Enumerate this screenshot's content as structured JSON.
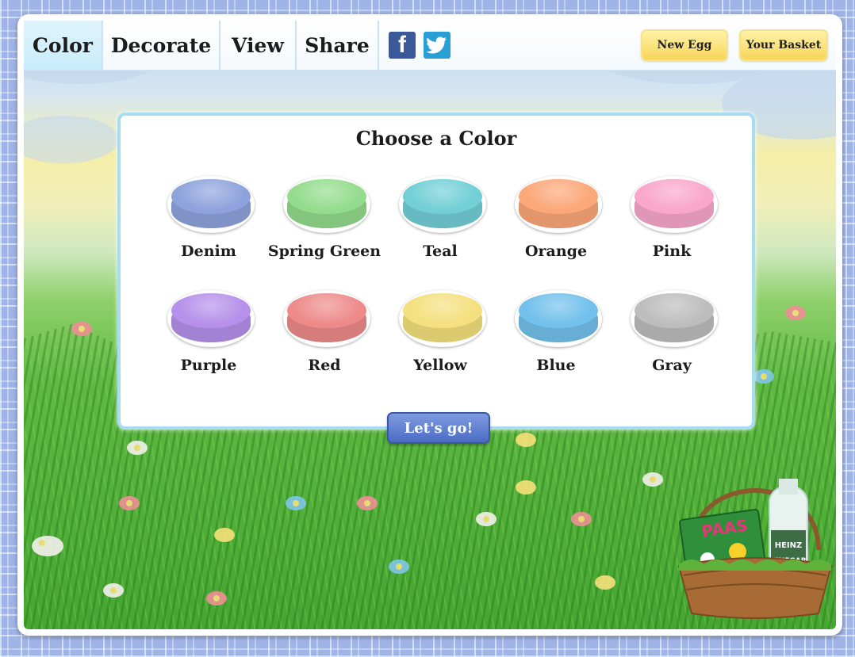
{
  "nav": {
    "tabs": [
      {
        "label": "Color",
        "active": true
      },
      {
        "label": "Decorate",
        "active": false
      },
      {
        "label": "View",
        "active": false
      },
      {
        "label": "Share",
        "active": false
      }
    ],
    "social": [
      {
        "icon": "facebook-icon",
        "glyph": "f",
        "color": "#3b5998"
      },
      {
        "icon": "twitter-icon",
        "glyph": "t",
        "color": "#2a9fd6"
      }
    ],
    "new_egg_label": "New Egg",
    "basket_label": "Your Basket"
  },
  "panel": {
    "title": "Choose a Color",
    "colors": [
      {
        "name": "Denim",
        "hex": "#8ea3dd"
      },
      {
        "name": "Spring Green",
        "hex": "#94dc8d"
      },
      {
        "name": "Teal",
        "hex": "#72cfd6"
      },
      {
        "name": "Orange",
        "hex": "#fca778"
      },
      {
        "name": "Pink",
        "hex": "#f9a7cb"
      },
      {
        "name": "Purple",
        "hex": "#b690ea"
      },
      {
        "name": "Red",
        "hex": "#ee8a8a"
      },
      {
        "name": "Yellow",
        "hex": "#f4e07e"
      },
      {
        "name": "Blue",
        "hex": "#72c0ec"
      },
      {
        "name": "Gray",
        "hex": "#bdbdbd"
      }
    ]
  },
  "go_label": "Let's go!",
  "basket": {
    "paas_text": "PAAS",
    "heinz_text": "HEINZ",
    "vinegar_text": "VINEGAR"
  }
}
